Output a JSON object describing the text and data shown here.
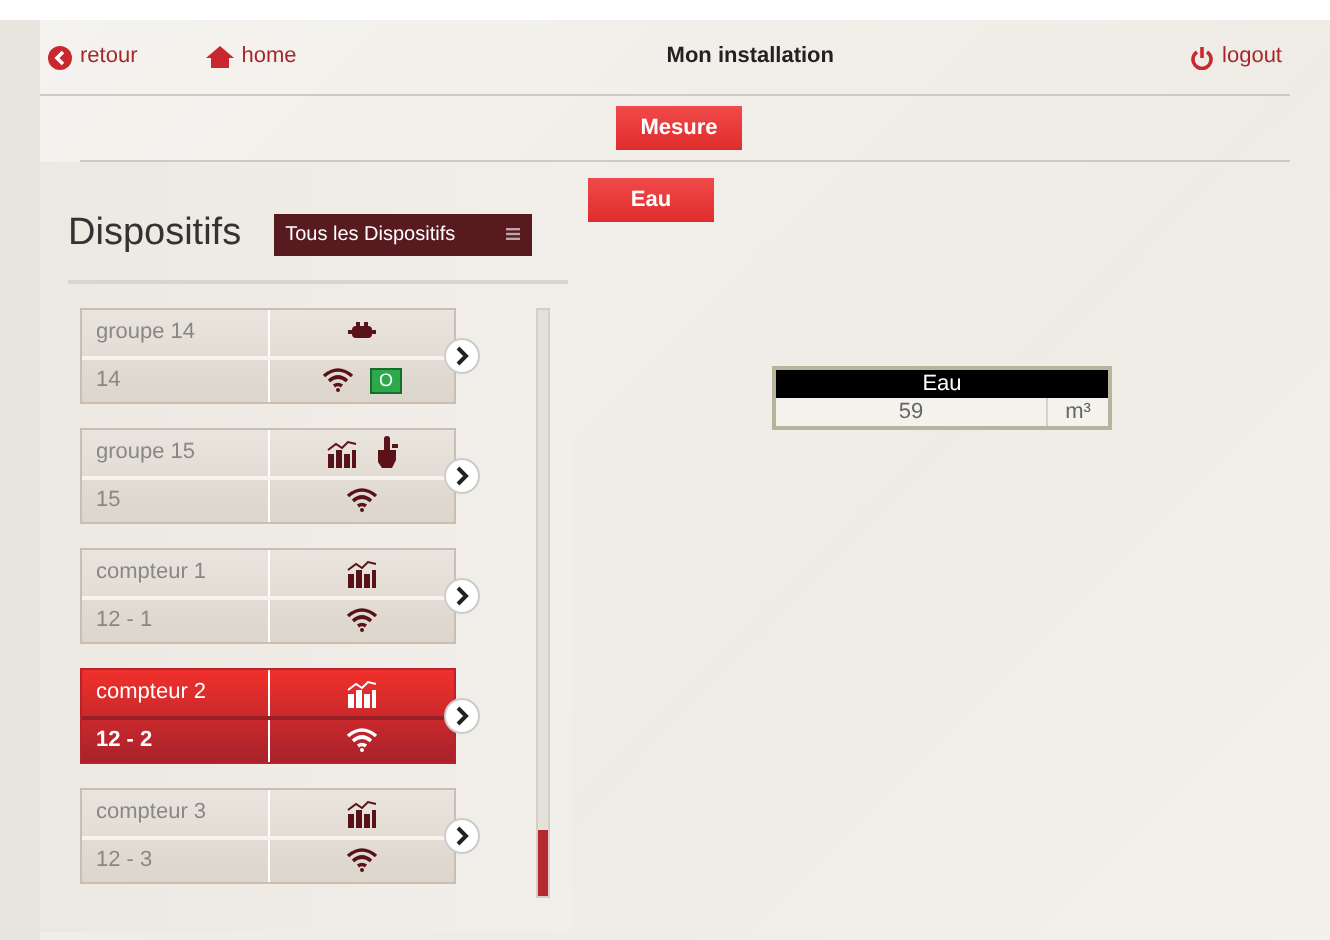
{
  "header": {
    "back": "retour",
    "home": "home",
    "title": "Mon installation",
    "logout": "logout"
  },
  "tabs": [
    {
      "label": "Mesure",
      "selected": true
    }
  ],
  "subtabs": [
    {
      "label": "Eau",
      "selected": true
    }
  ],
  "sidebar": {
    "heading": "Dispositifs",
    "filter": "Tous les Dispositifs",
    "items": [
      {
        "name": "groupe 14",
        "address": "14",
        "selected": false,
        "top_icons": [
          {
            "kind": "plug"
          }
        ],
        "bottom_icons": [
          {
            "kind": "wifi"
          }
        ],
        "state_badge": "O"
      },
      {
        "name": "groupe 15",
        "address": "15",
        "selected": false,
        "top_icons": [
          {
            "kind": "chart"
          },
          {
            "kind": "hand"
          }
        ],
        "bottom_icons": [
          {
            "kind": "wifi"
          }
        ]
      },
      {
        "name": "compteur 1",
        "address": "12 - 1",
        "selected": false,
        "top_icons": [
          {
            "kind": "chart"
          }
        ],
        "bottom_icons": [
          {
            "kind": "wifi"
          }
        ]
      },
      {
        "name": "compteur 2",
        "address": "12 - 2",
        "selected": true,
        "top_icons": [
          {
            "kind": "chart"
          }
        ],
        "bottom_icons": [
          {
            "kind": "wifi"
          }
        ]
      },
      {
        "name": "compteur 3",
        "address": "12 - 3",
        "selected": false,
        "top_icons": [
          {
            "kind": "chart"
          }
        ],
        "bottom_icons": [
          {
            "kind": "wifi"
          }
        ]
      }
    ]
  },
  "meter": {
    "title": "Eau",
    "value": "59",
    "unit": "m³"
  }
}
